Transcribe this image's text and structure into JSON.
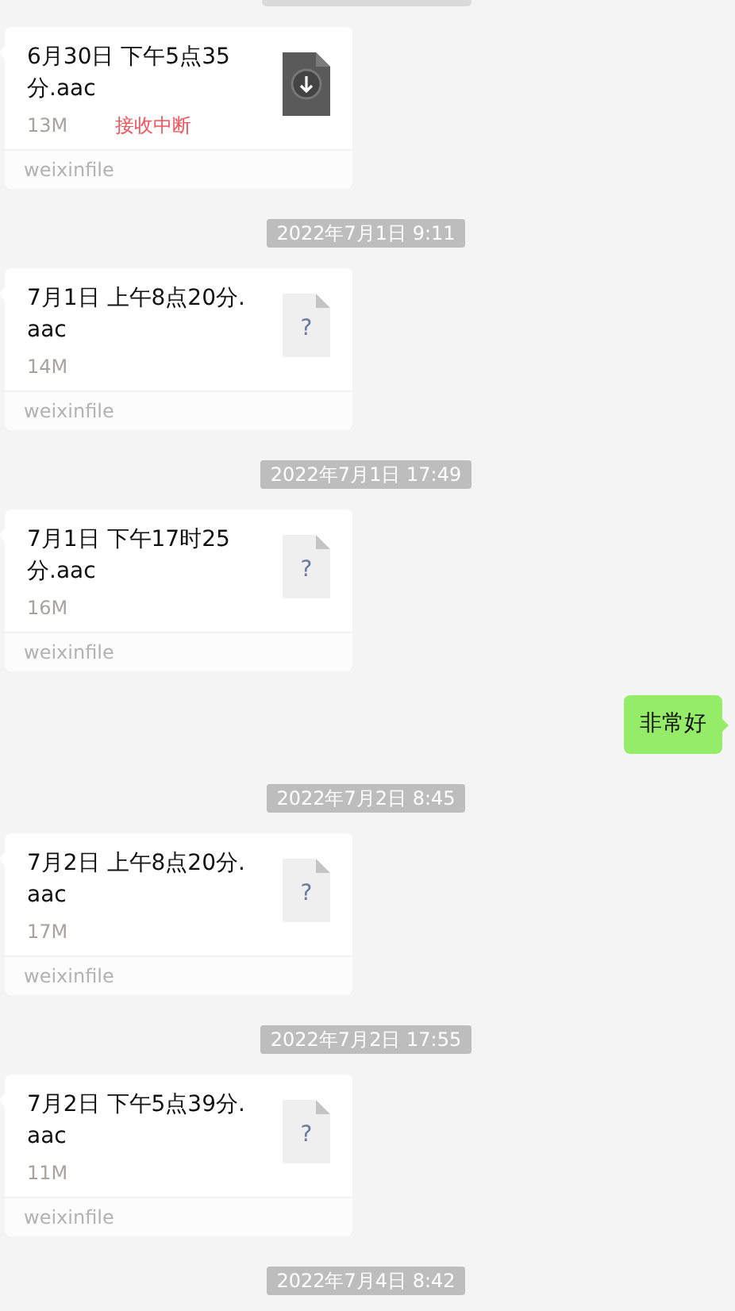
{
  "messages": [
    {
      "kind": "interrupted_file",
      "name": "6月30日 下午5点35分.aac",
      "size": "13M",
      "status": "接收中断",
      "source": "weixinfile"
    },
    {
      "kind": "time",
      "text": "2022年7月1日 9:11"
    },
    {
      "kind": "file",
      "name": "7月1日 上午8点20分.aac",
      "size": "14M",
      "glyph": "?",
      "source": "weixinfile"
    },
    {
      "kind": "time",
      "text": "2022年7月1日 17:49"
    },
    {
      "kind": "file",
      "name": "7月1日 下午17时25分.aac",
      "size": "16M",
      "glyph": "?",
      "source": "weixinfile"
    },
    {
      "kind": "text",
      "text": "非常好"
    },
    {
      "kind": "time",
      "text": "2022年7月2日 8:45"
    },
    {
      "kind": "file",
      "name": "7月2日 上午8点20分.aac",
      "size": "17M",
      "glyph": "?",
      "source": "weixinfile"
    },
    {
      "kind": "time",
      "text": "2022年7月2日 17:55"
    },
    {
      "kind": "file",
      "name": "7月2日 下午5点39分.aac",
      "size": "11M",
      "glyph": "?",
      "source": "weixinfile"
    },
    {
      "kind": "time",
      "text": "2022年7月4日 8:42"
    }
  ]
}
